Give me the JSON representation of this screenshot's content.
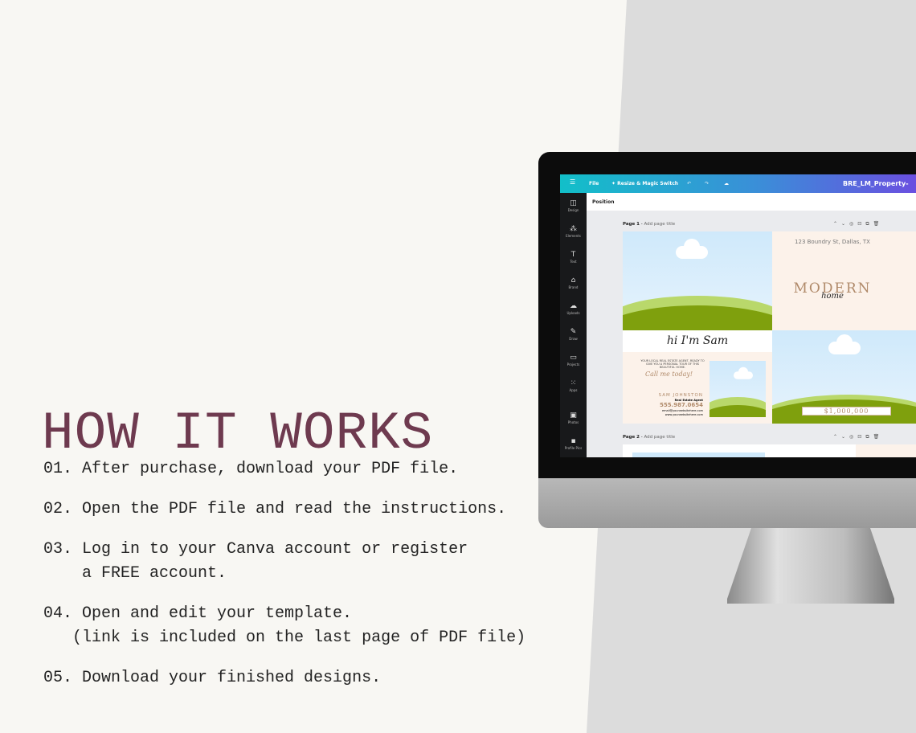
{
  "heading": "HOW IT WORKS",
  "steps": [
    "01. After purchase, download your PDF file.",
    "02. Open the PDF file and read the instructions.",
    "03. Log in to your Canva account or register\n    a FREE account.",
    "04. Open and edit your template.\n   (link is included on the last page of PDF file)",
    "05. Download your finished designs."
  ],
  "canva": {
    "menu": "File",
    "resize": "Resize & Magic Switch",
    "filename": "BRE_LM_Property-",
    "position": "Position",
    "sidebar": [
      "Design",
      "Elements",
      "Text",
      "Brand",
      "Uploads",
      "Draw",
      "Projects",
      "Apps",
      "Photos",
      "Profile Pics"
    ],
    "pages": [
      {
        "label": "Page 1",
        "title": "Add page title"
      },
      {
        "label": "Page 2",
        "title": "Add page title"
      }
    ],
    "design": {
      "address": "123 Boundry St, Dallas, TX",
      "modern": "MODERN",
      "home": "home",
      "greeting": "hi I'm Sam",
      "intro": "YOUR LOCAL REAL ESTATE AGENT, READY TO GIVE YOU A PERSONAL TOUR OF THIS BEAUTIFUL HOME.",
      "call": "Call me today!",
      "agent": "SAM JOHNSTON",
      "role": "Real Estate Agent",
      "phone": "555.987.0654",
      "email": "email@yourwebsitehere.com",
      "web": "www.yourwebsitehere.com",
      "price": "$1,000,000"
    }
  }
}
